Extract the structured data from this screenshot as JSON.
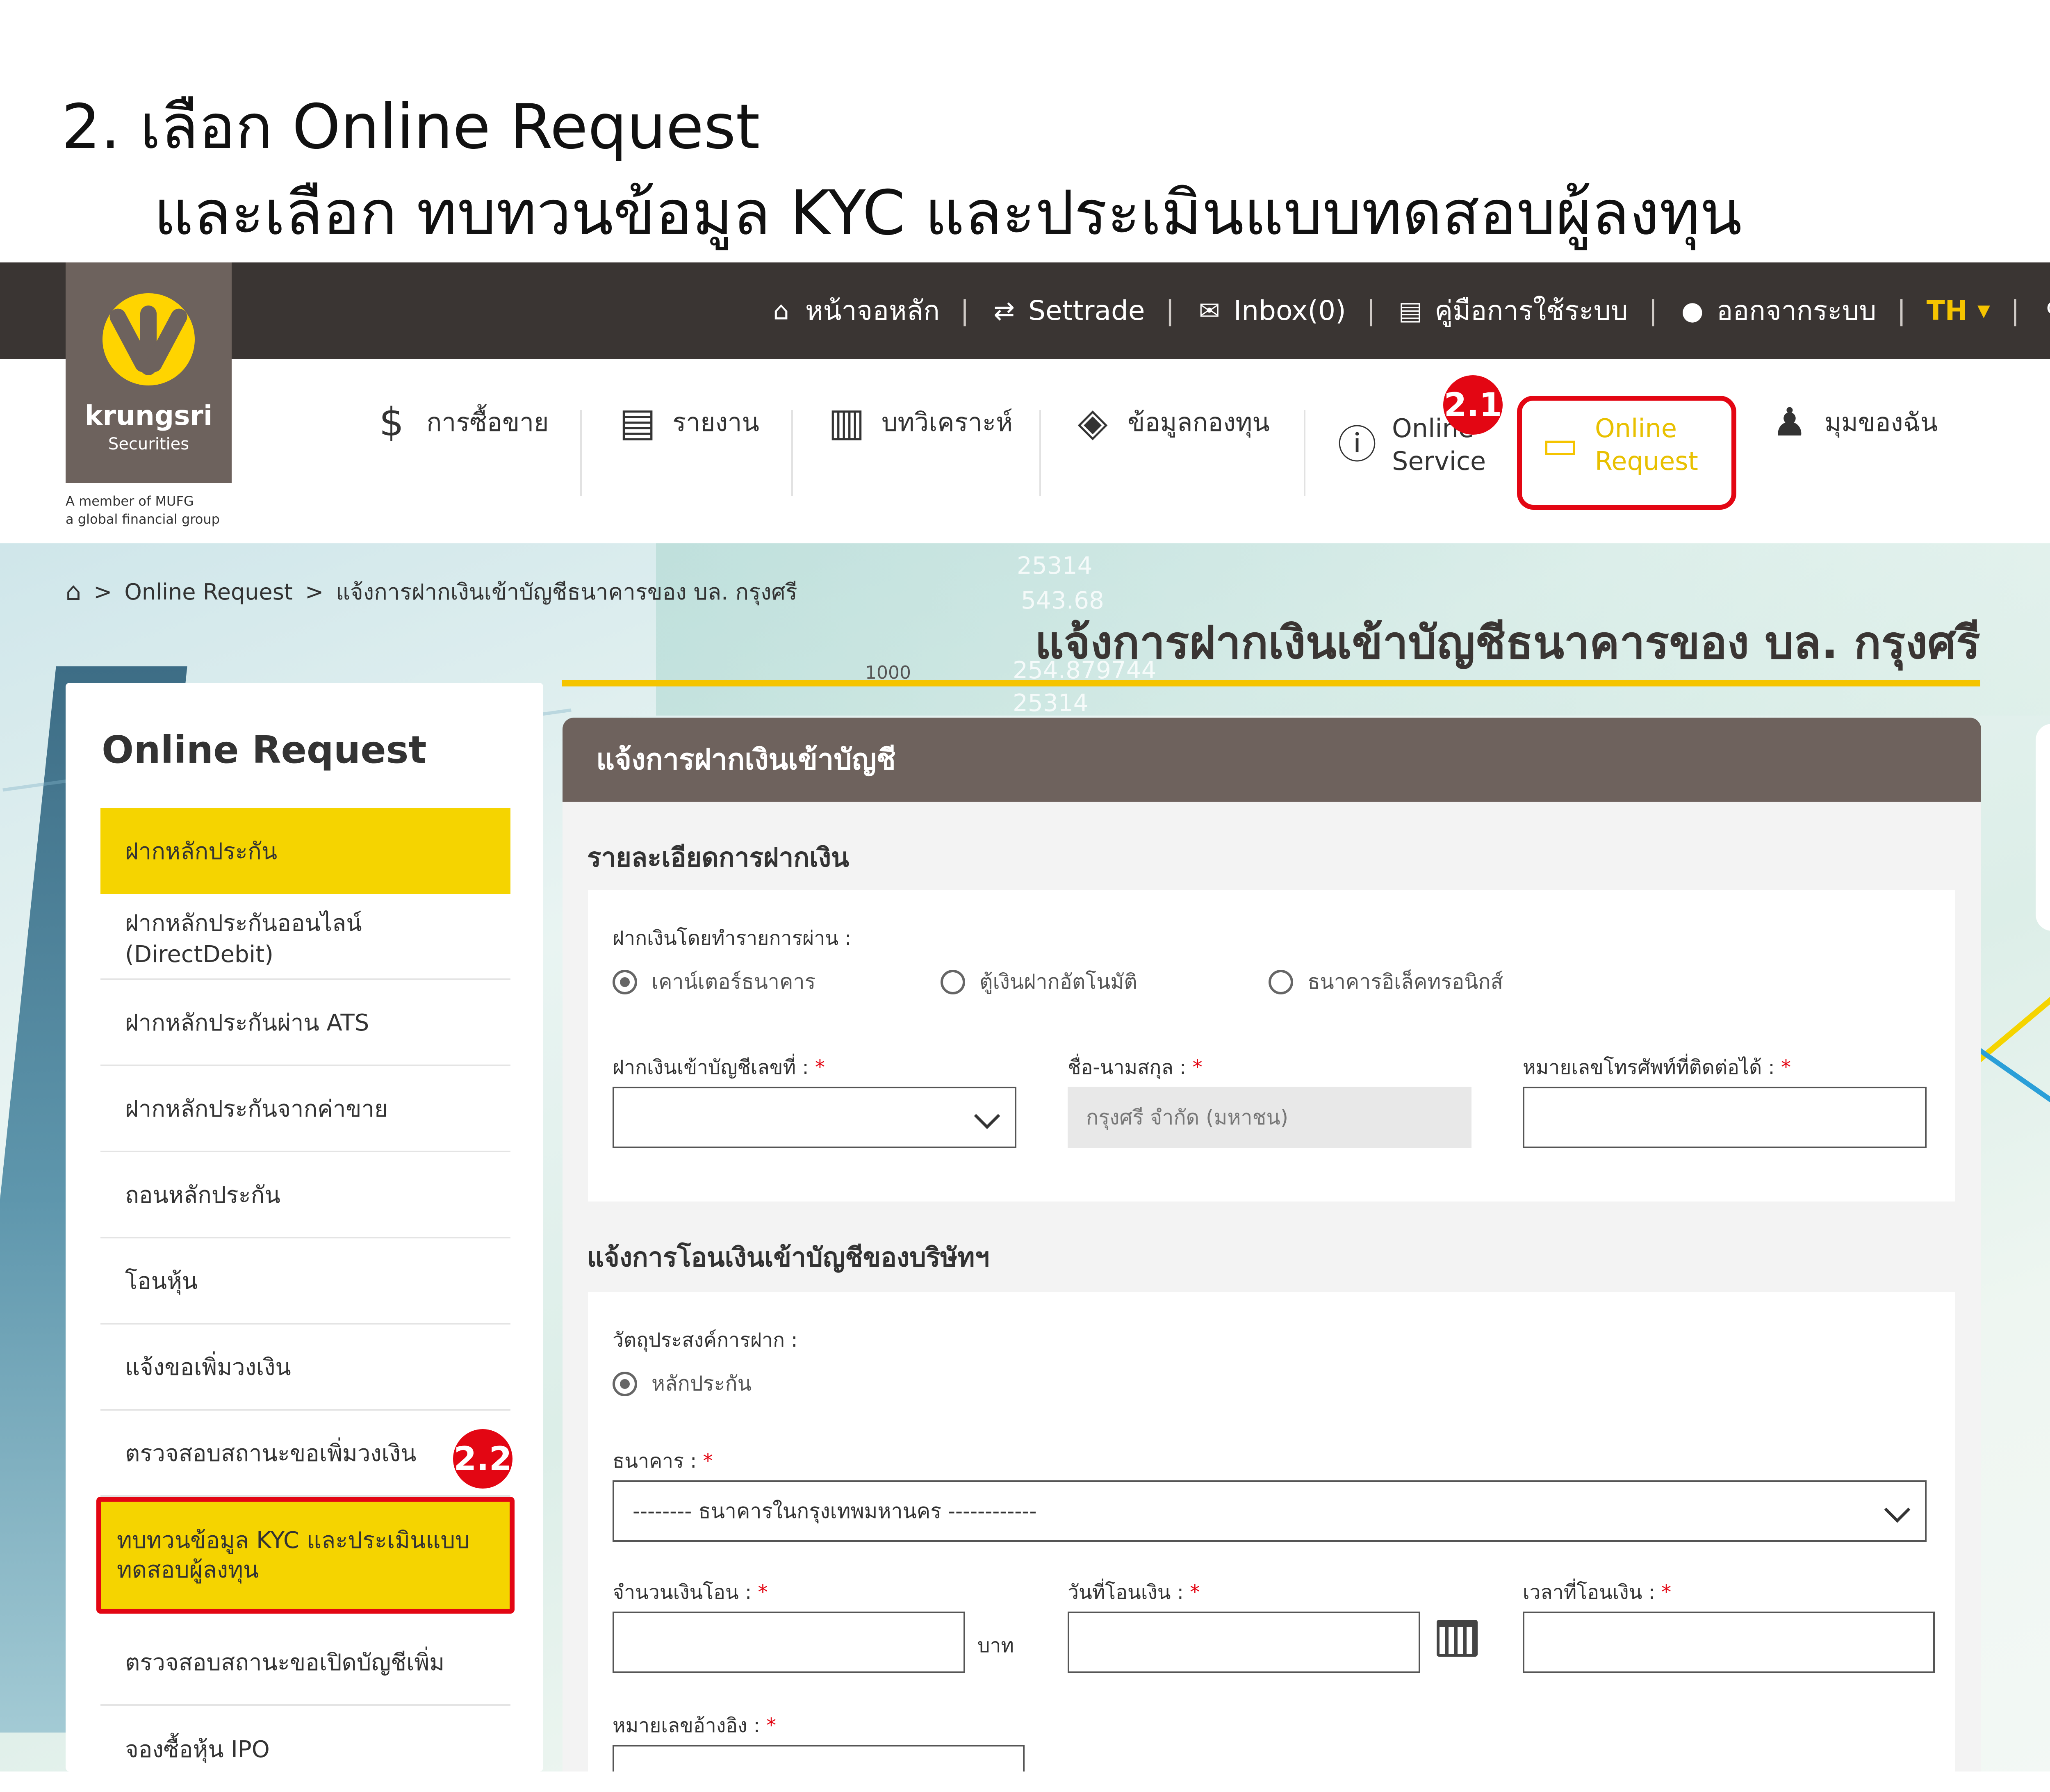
{
  "instructions": {
    "line1": "2.  เลือก Online Request",
    "line2": "และเลือก ทบทวนข้อมูล KYC และประเมินแบบทดสอบผู้ลงทุน"
  },
  "logo": {
    "name": "krungsri",
    "sub": "Securities",
    "tagline1": "A member of  MUFG",
    "tagline2": "a global financial group"
  },
  "topnav": {
    "home": "หน้าจอหลัก",
    "settrade": "Settrade",
    "inbox": "Inbox(0)",
    "manual": "คู่มือการใช้ระบบ",
    "logout": "ออกจากระบบ",
    "lang": "TH"
  },
  "mainmenu": {
    "trade": "การซื้อขาย",
    "report": "รายงาน",
    "analysis": "บทวิเคราะห์",
    "fund": "ข้อมูลกองทุน",
    "online_service_1": "Online",
    "online_service_2": "Service",
    "online_request_1": "Online",
    "online_request_2": "Request",
    "my_corner": "มุมของฉัน"
  },
  "badges": {
    "b1": "2.1",
    "b2": "2.2"
  },
  "breadcrumb": {
    "item1": "Online Request",
    "item2": "แจ้งการฝากเงินเข้าบัญชีธนาคารของ บล. กรุงศรี"
  },
  "page_title": "แจ้งการฝากเงินเข้าบัญชีธนาคารของ บล. กรุงศรี",
  "hero_numbers": [
    "25314",
    "543.68",
    "254.879744",
    "25314",
    "1000"
  ],
  "sidebar": {
    "title": "Online Request",
    "items": [
      "ฝากหลักประกัน",
      "ฝากหลักประกันออนไลน์ (DirectDebit)",
      "ฝากหลักประกันผ่าน ATS",
      "ฝากหลักประกันจากค่าขาย",
      "ถอนหลักประกัน",
      "โอนหุ้น",
      "แจ้งขอเพิ่มวงเงิน",
      "ตรวจสอบสถานะขอเพิ่มวงเงิน",
      "ทบทวนข้อมูล KYC และประเมินแบบ",
      "ทดสอบผู้ลงทุน",
      "ตรวจสอบสถานะขอเปิดบัญชีเพิ่ม",
      "จองซื้อหุ้น IPO"
    ]
  },
  "panel": {
    "header": "แจ้งการฝากเงินเข้าบัญชี",
    "section1": "รายละเอียดการฝากเงิน",
    "deposit_via": "ฝากเงินโดยทำรายการผ่าน :",
    "radio1": "เคาน์เตอร์ธนาคาร",
    "radio2": "ตู้เงินฝากอัตโนมัติ",
    "radio3": "ธนาคารอิเล็คทรอนิกส์",
    "account_label": "ฝากเงินเข้าบัญชีเลขที่ :",
    "name_label": "ชื่อ-นามสกุล :",
    "name_value": "กรุงศรี จำกัด (มหาชน)",
    "phone_label": "หมายเลขโทรศัพท์ที่ติดต่อได้ :",
    "section2": "แจ้งการโอนเงินเข้าบัญชีของบริษัทฯ",
    "purpose_label": "วัตถุประสงค์การฝาก :",
    "purpose_radio": "หลักประกัน",
    "bank_label": "ธนาคาร :",
    "bank_value": "-------- ธนาคารในกรุงเทพมหานคร ------------",
    "amount_label": "จำนวนเงินโอน :",
    "baht": "บาท",
    "date_label": "วันที่โอนเงิน :",
    "time_label": "เวลาที่โอนเงิน :",
    "ref_label": "หมายเลขอ้างอิง :",
    "required_mark": "*"
  },
  "colors": {
    "accent": "#f5d400",
    "highlight": "#e30613",
    "nav": "#3a3533",
    "panel_header": "#6e625d"
  },
  "icons": [
    "home-icon",
    "swap-icon",
    "mail-icon",
    "book-icon",
    "user-icon",
    "caret-down-icon",
    "search-icon",
    "trade-icon",
    "report-icon",
    "analysis-icon",
    "layers-icon",
    "info-icon",
    "folder-icon",
    "person-icon",
    "chevron-down-icon",
    "calendar-icon"
  ]
}
